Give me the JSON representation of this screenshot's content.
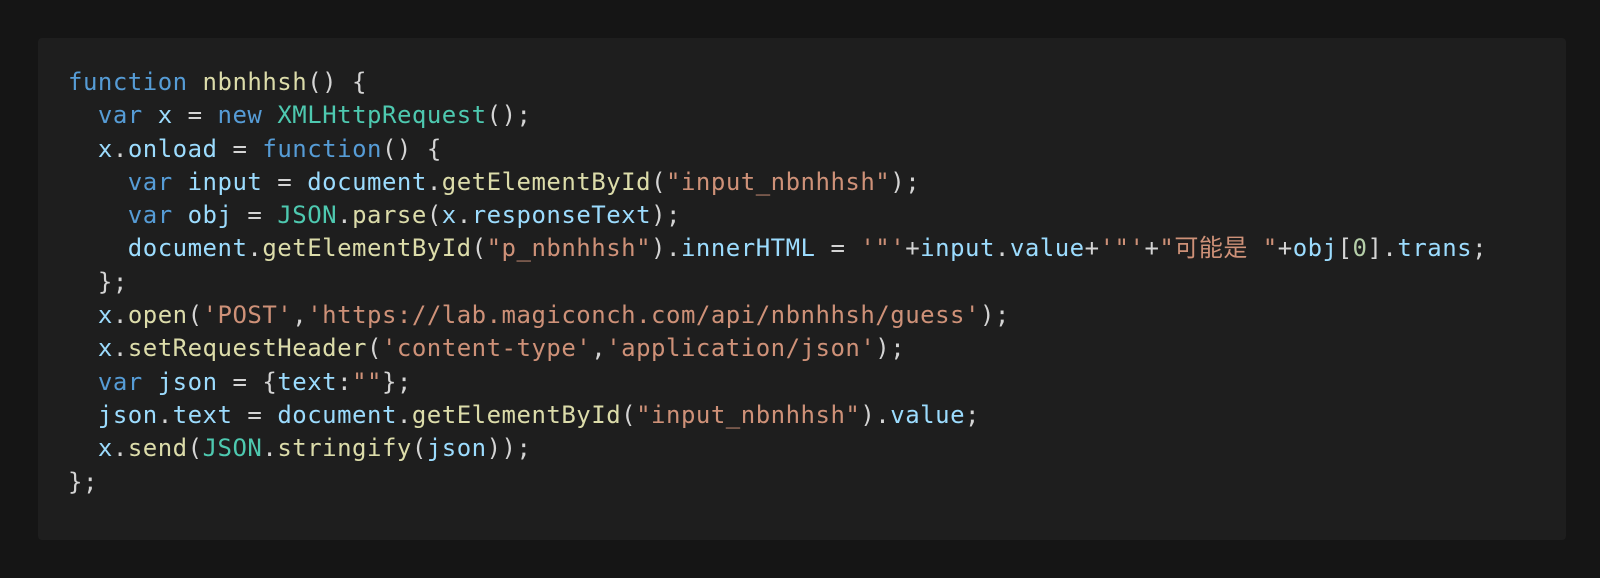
{
  "colors": {
    "background": "#151515",
    "panel": "#1e1e1e",
    "keyword": "#569cd6",
    "function": "#dcdcaa",
    "variable": "#9cdcfe",
    "class": "#4ec9b0",
    "string": "#ce9178",
    "number": "#b5cea8",
    "plain": "#d4d4d4"
  },
  "code": {
    "language": "javascript",
    "lines": [
      [
        {
          "t": "function",
          "c": "keyword"
        },
        {
          "t": " ",
          "c": "plain"
        },
        {
          "t": "nbnhhsh",
          "c": "func"
        },
        {
          "t": "() {",
          "c": "plain"
        }
      ],
      [
        {
          "t": "  ",
          "c": "plain"
        },
        {
          "t": "var",
          "c": "keyword"
        },
        {
          "t": " ",
          "c": "plain"
        },
        {
          "t": "x",
          "c": "var"
        },
        {
          "t": " = ",
          "c": "plain"
        },
        {
          "t": "new",
          "c": "keyword"
        },
        {
          "t": " ",
          "c": "plain"
        },
        {
          "t": "XMLHttpRequest",
          "c": "class"
        },
        {
          "t": "();",
          "c": "plain"
        }
      ],
      [
        {
          "t": "  ",
          "c": "plain"
        },
        {
          "t": "x",
          "c": "var"
        },
        {
          "t": ".",
          "c": "plain"
        },
        {
          "t": "onload",
          "c": "var"
        },
        {
          "t": " = ",
          "c": "plain"
        },
        {
          "t": "function",
          "c": "keyword"
        },
        {
          "t": "() {",
          "c": "plain"
        }
      ],
      [
        {
          "t": "    ",
          "c": "plain"
        },
        {
          "t": "var",
          "c": "keyword"
        },
        {
          "t": " ",
          "c": "plain"
        },
        {
          "t": "input",
          "c": "var"
        },
        {
          "t": " = ",
          "c": "plain"
        },
        {
          "t": "document",
          "c": "var"
        },
        {
          "t": ".",
          "c": "plain"
        },
        {
          "t": "getElementById",
          "c": "func"
        },
        {
          "t": "(",
          "c": "plain"
        },
        {
          "t": "\"input_nbnhhsh\"",
          "c": "string"
        },
        {
          "t": ");",
          "c": "plain"
        }
      ],
      [
        {
          "t": "    ",
          "c": "plain"
        },
        {
          "t": "var",
          "c": "keyword"
        },
        {
          "t": " ",
          "c": "plain"
        },
        {
          "t": "obj",
          "c": "var"
        },
        {
          "t": " = ",
          "c": "plain"
        },
        {
          "t": "JSON",
          "c": "class"
        },
        {
          "t": ".",
          "c": "plain"
        },
        {
          "t": "parse",
          "c": "func"
        },
        {
          "t": "(",
          "c": "plain"
        },
        {
          "t": "x",
          "c": "var"
        },
        {
          "t": ".",
          "c": "plain"
        },
        {
          "t": "responseText",
          "c": "var"
        },
        {
          "t": ");",
          "c": "plain"
        }
      ],
      [
        {
          "t": "    ",
          "c": "plain"
        },
        {
          "t": "document",
          "c": "var"
        },
        {
          "t": ".",
          "c": "plain"
        },
        {
          "t": "getElementById",
          "c": "func"
        },
        {
          "t": "(",
          "c": "plain"
        },
        {
          "t": "\"p_nbnhhsh\"",
          "c": "string"
        },
        {
          "t": ").",
          "c": "plain"
        },
        {
          "t": "innerHTML",
          "c": "var"
        },
        {
          "t": " = ",
          "c": "plain"
        },
        {
          "t": "'\"'",
          "c": "string"
        },
        {
          "t": "+",
          "c": "plain"
        },
        {
          "t": "input",
          "c": "var"
        },
        {
          "t": ".",
          "c": "plain"
        },
        {
          "t": "value",
          "c": "var"
        },
        {
          "t": "+",
          "c": "plain"
        },
        {
          "t": "'\"'",
          "c": "string"
        },
        {
          "t": "+",
          "c": "plain"
        },
        {
          "t": "\"可能是 \"",
          "c": "string"
        },
        {
          "t": "+",
          "c": "plain"
        },
        {
          "t": "obj",
          "c": "var"
        },
        {
          "t": "[",
          "c": "plain"
        },
        {
          "t": "0",
          "c": "number"
        },
        {
          "t": "].",
          "c": "plain"
        },
        {
          "t": "trans",
          "c": "var"
        },
        {
          "t": ";",
          "c": "plain"
        }
      ],
      [
        {
          "t": "  };",
          "c": "plain"
        }
      ],
      [
        {
          "t": "  ",
          "c": "plain"
        },
        {
          "t": "x",
          "c": "var"
        },
        {
          "t": ".",
          "c": "plain"
        },
        {
          "t": "open",
          "c": "func"
        },
        {
          "t": "(",
          "c": "plain"
        },
        {
          "t": "'POST'",
          "c": "string"
        },
        {
          "t": ",",
          "c": "plain"
        },
        {
          "t": "'https://lab.magiconch.com/api/nbnhhsh/guess'",
          "c": "string"
        },
        {
          "t": ");",
          "c": "plain"
        }
      ],
      [
        {
          "t": "  ",
          "c": "plain"
        },
        {
          "t": "x",
          "c": "var"
        },
        {
          "t": ".",
          "c": "plain"
        },
        {
          "t": "setRequestHeader",
          "c": "func"
        },
        {
          "t": "(",
          "c": "plain"
        },
        {
          "t": "'content-type'",
          "c": "string"
        },
        {
          "t": ",",
          "c": "plain"
        },
        {
          "t": "'application/json'",
          "c": "string"
        },
        {
          "t": ");",
          "c": "plain"
        }
      ],
      [
        {
          "t": "  ",
          "c": "plain"
        },
        {
          "t": "var",
          "c": "keyword"
        },
        {
          "t": " ",
          "c": "plain"
        },
        {
          "t": "json",
          "c": "var"
        },
        {
          "t": " = {",
          "c": "plain"
        },
        {
          "t": "text",
          "c": "var"
        },
        {
          "t": ":",
          "c": "plain"
        },
        {
          "t": "\"\"",
          "c": "string"
        },
        {
          "t": "};",
          "c": "plain"
        }
      ],
      [
        {
          "t": "  ",
          "c": "plain"
        },
        {
          "t": "json",
          "c": "var"
        },
        {
          "t": ".",
          "c": "plain"
        },
        {
          "t": "text",
          "c": "var"
        },
        {
          "t": " = ",
          "c": "plain"
        },
        {
          "t": "document",
          "c": "var"
        },
        {
          "t": ".",
          "c": "plain"
        },
        {
          "t": "getElementById",
          "c": "func"
        },
        {
          "t": "(",
          "c": "plain"
        },
        {
          "t": "\"input_nbnhhsh\"",
          "c": "string"
        },
        {
          "t": ").",
          "c": "plain"
        },
        {
          "t": "value",
          "c": "var"
        },
        {
          "t": ";",
          "c": "plain"
        }
      ],
      [
        {
          "t": "  ",
          "c": "plain"
        },
        {
          "t": "x",
          "c": "var"
        },
        {
          "t": ".",
          "c": "plain"
        },
        {
          "t": "send",
          "c": "func"
        },
        {
          "t": "(",
          "c": "plain"
        },
        {
          "t": "JSON",
          "c": "class"
        },
        {
          "t": ".",
          "c": "plain"
        },
        {
          "t": "stringify",
          "c": "func"
        },
        {
          "t": "(",
          "c": "plain"
        },
        {
          "t": "json",
          "c": "var"
        },
        {
          "t": "));",
          "c": "plain"
        }
      ],
      [
        {
          "t": "};",
          "c": "plain"
        }
      ]
    ]
  }
}
